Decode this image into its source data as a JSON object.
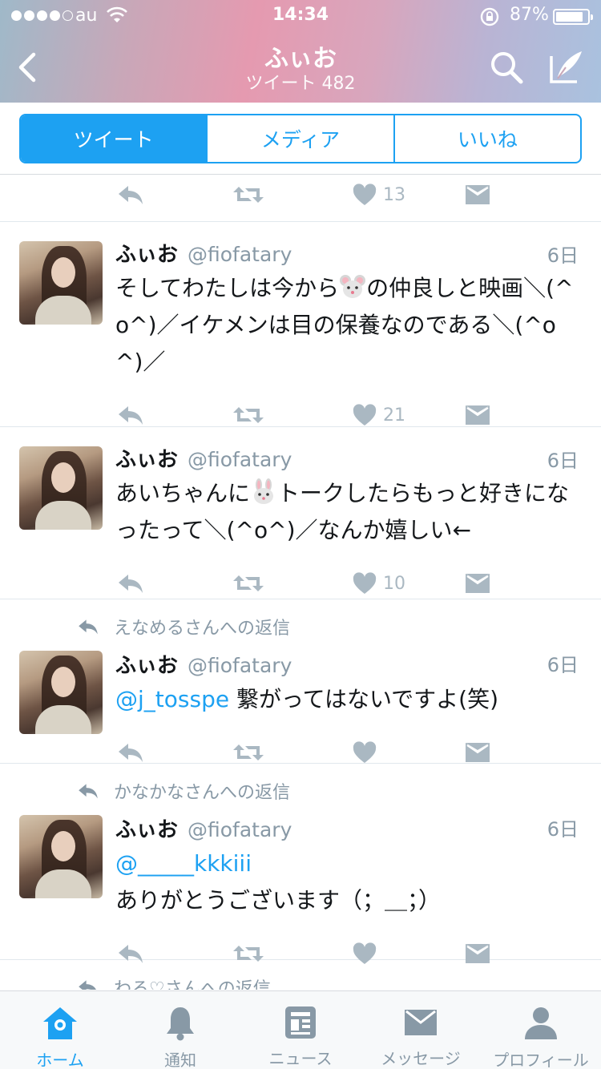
{
  "status_bar": {
    "carrier": "au",
    "time": "14:34",
    "battery": "87%",
    "battery_level": 0.87
  },
  "header": {
    "title": "ふぃお",
    "subtitle": "ツイート 482"
  },
  "segments": [
    {
      "label": "ツイート",
      "active": true
    },
    {
      "label": "メディア",
      "active": false
    },
    {
      "label": "いいね",
      "active": false
    }
  ],
  "partial_tweet": {
    "likes": "13"
  },
  "tweets": [
    {
      "name": "ふぃお",
      "handle": "@fiofatary",
      "date": "6日",
      "text_before": "そしてわたしは今から",
      "emoji": "mouse-face",
      "text_after": "の仲良しと映画＼(^o^)／イケメンは目の保養なのである＼(^o^)／",
      "likes": "21"
    },
    {
      "name": "ふぃお",
      "handle": "@fiofatary",
      "date": "6日",
      "text_before": "あいちゃんに",
      "emoji": "rabbit-face",
      "text_after": "トークしたらもっと好きになったって＼(^o^)／なんか嬉しい←",
      "likes": "10"
    },
    {
      "reply_context": "えなめるさんへの返信",
      "name": "ふぃお",
      "handle": "@fiofatary",
      "date": "6日",
      "mention": "@j_tosspe",
      "text": " 繋がってはないですよ(笑)",
      "likes": ""
    },
    {
      "reply_context": "かなかなさんへの返信",
      "name": "ふぃお",
      "handle": "@fiofatary",
      "date": "6日",
      "mention": "@_____kkkiii",
      "text": " ありがとうございます（；＿；）",
      "likes": ""
    },
    {
      "reply_context": "わろ♡さんへの返信"
    }
  ],
  "tabbar": [
    {
      "label": "ホーム",
      "icon": "home-icon",
      "active": true
    },
    {
      "label": "通知",
      "icon": "bell-icon",
      "active": false
    },
    {
      "label": "ニュース",
      "icon": "news-icon",
      "active": false
    },
    {
      "label": "メッセージ",
      "icon": "envelope-icon",
      "active": false
    },
    {
      "label": "プロフィール",
      "icon": "profile-icon",
      "active": false
    }
  ],
  "colors": {
    "accent": "#1da1f2",
    "muted": "#8899a6",
    "action_gray": "#aab8c2"
  }
}
